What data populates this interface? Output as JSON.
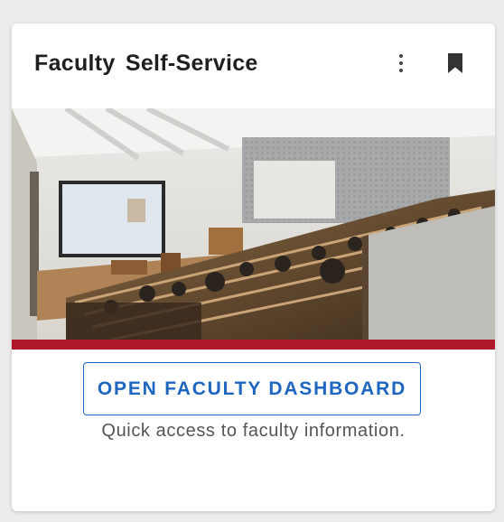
{
  "card": {
    "title": "Faculty Self-Service",
    "menu_icon": "more-vert-icon",
    "bookmark_icon": "bookmark-icon",
    "image_alt": "Lecture hall with audience facing a projection screen",
    "accent_color": "#b0162a",
    "cta_label": "OPEN FACULTY DASHBOARD",
    "cta_color": "#1f66c1",
    "description": "Quick access to faculty information."
  }
}
